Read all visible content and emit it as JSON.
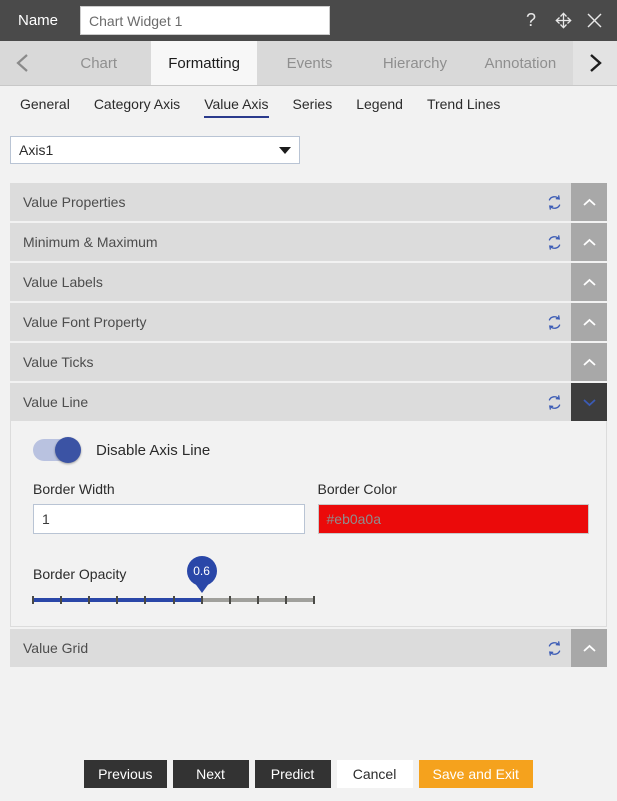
{
  "titlebar": {
    "label": "Name",
    "input_value": "Chart Widget 1",
    "input_placeholder": "Chart Widget 1",
    "help_icon": "question-mark-icon",
    "move_icon": "move-icon",
    "close_icon": "close-icon"
  },
  "main_tabs": {
    "prev_arrow": "chevron-left-icon",
    "next_arrow": "chevron-right-icon",
    "items": [
      {
        "label": "Chart",
        "active": false
      },
      {
        "label": "Formatting",
        "active": true
      },
      {
        "label": "Events",
        "active": false
      },
      {
        "label": "Hierarchy",
        "active": false
      },
      {
        "label": "Annotation",
        "active": false
      }
    ]
  },
  "sub_tabs": {
    "items": [
      {
        "label": "General",
        "active": false
      },
      {
        "label": "Category Axis",
        "active": false
      },
      {
        "label": "Value Axis",
        "active": true
      },
      {
        "label": "Series",
        "active": false
      },
      {
        "label": "Legend",
        "active": false
      },
      {
        "label": "Trend Lines",
        "active": false
      }
    ]
  },
  "axis_select": {
    "value": "Axis1",
    "caret_icon": "caret-down-icon"
  },
  "accordion": {
    "refresh_icon": "refresh-icon",
    "chevron_up_icon": "chevron-up-icon",
    "chevron_down_icon": "chevron-down-icon",
    "sections": [
      {
        "title": "Value Properties",
        "has_refresh": true,
        "expanded": false
      },
      {
        "title": "Minimum & Maximum",
        "has_refresh": true,
        "expanded": false
      },
      {
        "title": "Value Labels",
        "has_refresh": false,
        "expanded": false
      },
      {
        "title": "Value Font Property",
        "has_refresh": true,
        "expanded": false
      },
      {
        "title": "Value Ticks",
        "has_refresh": false,
        "expanded": false
      },
      {
        "title": "Value Line",
        "has_refresh": true,
        "expanded": true
      },
      {
        "title": "Value Grid",
        "has_refresh": true,
        "expanded": false
      }
    ]
  },
  "value_line_panel": {
    "toggle_label": "Disable Axis Line",
    "toggle_on": true,
    "border_width_label": "Border Width",
    "border_width_value": "1",
    "border_color_label": "Border Color",
    "border_color_value": "#eb0a0a",
    "border_color_swatch": "#eb0a0a",
    "border_opacity_label": "Border Opacity",
    "border_opacity_value": "0.6",
    "border_opacity_percent": 60,
    "slider_tick_count": 10
  },
  "footer": {
    "buttons": [
      {
        "label": "Previous",
        "style": "dark"
      },
      {
        "label": "Next",
        "style": "dark"
      },
      {
        "label": "Predict",
        "style": "dark"
      },
      {
        "label": "Cancel",
        "style": "light"
      },
      {
        "label": "Save and Exit",
        "style": "accent"
      }
    ]
  }
}
